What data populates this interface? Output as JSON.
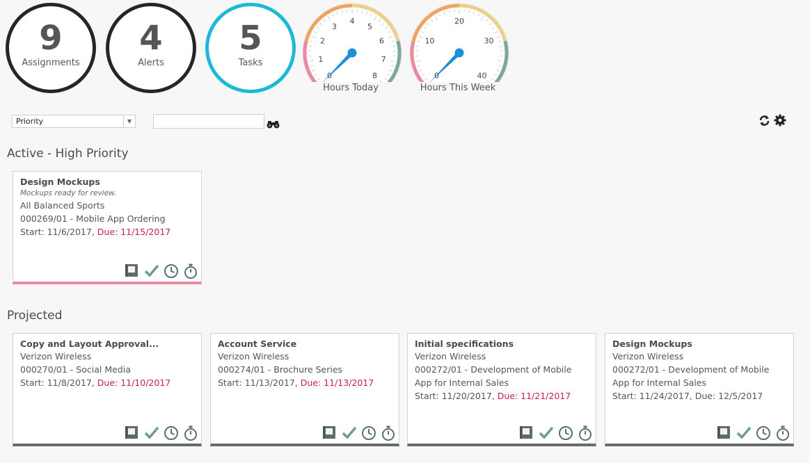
{
  "stats": [
    {
      "value": "9",
      "label": "Assignments"
    },
    {
      "value": "4",
      "label": "Alerts"
    },
    {
      "value": "5",
      "label": "Tasks"
    }
  ],
  "gauges": {
    "today": {
      "label": "Hours Today",
      "ticks": [
        "0",
        "1",
        "2",
        "3",
        "4",
        "5",
        "6",
        "7",
        "8"
      ],
      "value": 0,
      "min": 0,
      "max": 8
    },
    "week": {
      "label": "Hours This Week",
      "ticks": [
        "0",
        "10",
        "20",
        "30",
        "40"
      ],
      "value": 0,
      "min": 0,
      "max": 40
    }
  },
  "colors": {
    "tasks_ring": "#1ab9d4",
    "gauge_low": "#e88aa0",
    "gauge_mid_low": "#efa55f",
    "gauge_mid_high": "#efd08a",
    "gauge_high": "#7aa89a",
    "needle": "#1c8fd8",
    "due": "#c8213f",
    "priority_bar": "#e88aa0"
  },
  "toolbar": {
    "sort_value": "Priority",
    "search_value": "",
    "search_icon": "binoculars-icon",
    "refresh_icon": "refresh-icon",
    "settings_icon": "gear-icon"
  },
  "sections": {
    "active_title": "Active - High Priority",
    "projected_title": "Projected"
  },
  "active_cards": [
    {
      "title": "Design Mockups",
      "note": "Mockups ready for review.",
      "client": "All Balanced Sports",
      "project": "000269/01 - Mobile App Ordering",
      "start": "Start: 11/6/2017, ",
      "due": "Due: 11/15/2017"
    }
  ],
  "projected_cards": [
    {
      "title": "Copy and Layout Approval...",
      "client": "Verizon Wireless",
      "project": "000270/01 - Social Media",
      "start": "Start: 11/8/2017, ",
      "due": "Due: 11/10/2017"
    },
    {
      "title": "Account Service",
      "client": "Verizon Wireless",
      "project": "000274/01 - Brochure Series",
      "start": "Start: 11/13/2017, ",
      "due": "Due: 11/13/2017"
    },
    {
      "title": "Initial specifications",
      "client": "Verizon Wireless",
      "project": "000272/01 - Development of Mobile App for Internal Sales",
      "start": "Start: 11/20/2017, ",
      "due": "Due: 11/21/2017"
    },
    {
      "title": "Design Mockups",
      "client": "Verizon Wireless",
      "project": "000272/01 - Development of Mobile App for Internal Sales",
      "start": "Start: 11/24/2017, Due: 12/5/2017",
      "due": ""
    }
  ],
  "card_action_icons": [
    "notebook-icon",
    "checkmark-icon",
    "clock-icon",
    "stopwatch-icon"
  ]
}
